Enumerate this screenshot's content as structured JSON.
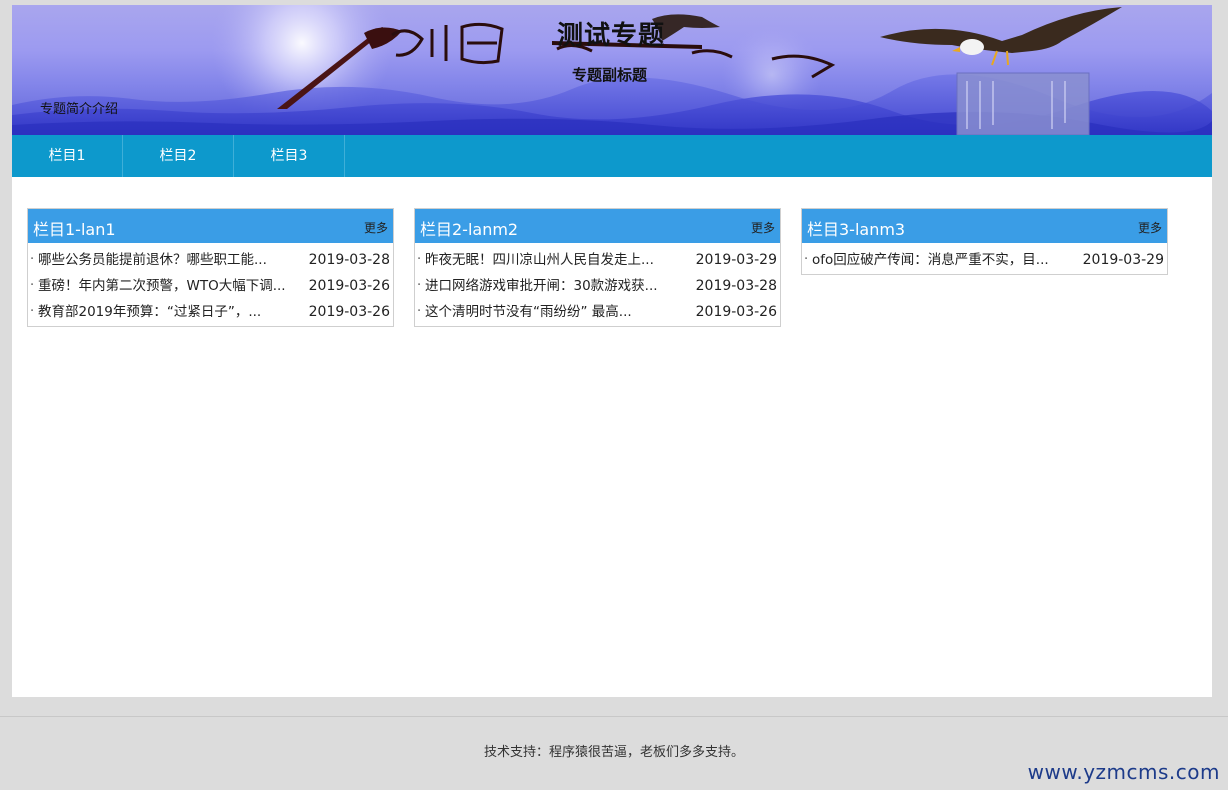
{
  "banner": {
    "title": "测试专题",
    "subtitle": "专题副标题",
    "intro": "专题简介介绍",
    "art_text": "创意世界"
  },
  "nav": {
    "items": [
      {
        "label": "栏目1"
      },
      {
        "label": "栏目2"
      },
      {
        "label": "栏目3"
      }
    ]
  },
  "boxes": [
    {
      "title": "栏目1-lan1",
      "more": "更多",
      "rows": [
        {
          "title": "哪些公务员能提前退休？哪些职工能...",
          "date": "2019-03-28"
        },
        {
          "title": "重磅！年内第二次预警，WTO大幅下调...",
          "date": "2019-03-26"
        },
        {
          "title": "教育部2019年预算：“过紧日子”，...",
          "date": "2019-03-26"
        }
      ]
    },
    {
      "title": "栏目2-lanm2",
      "more": "更多",
      "rows": [
        {
          "title": "昨夜无眠！四川凉山州人民自发走上...",
          "date": "2019-03-29"
        },
        {
          "title": "进口网络游戏审批开闸：30款游戏获...",
          "date": "2019-03-28"
        },
        {
          "title": "这个清明时节没有“雨纷纷” 最高...",
          "date": "2019-03-26"
        }
      ]
    },
    {
      "title": "栏目3-lanm3",
      "more": "更多",
      "rows": [
        {
          "title": "ofo回应破产传闻：消息严重不实，目...",
          "date": "2019-03-29"
        }
      ]
    }
  ],
  "bullet": "·",
  "footer": {
    "text": "技术支持：程序猿很苦逼，老板们多多支持。"
  },
  "watermark": "www.yzmcms.com",
  "colors": {
    "nav_bg": "#0d99cc",
    "box_head_bg": "#3a9de6",
    "page_bg": "#dcdcdc"
  }
}
